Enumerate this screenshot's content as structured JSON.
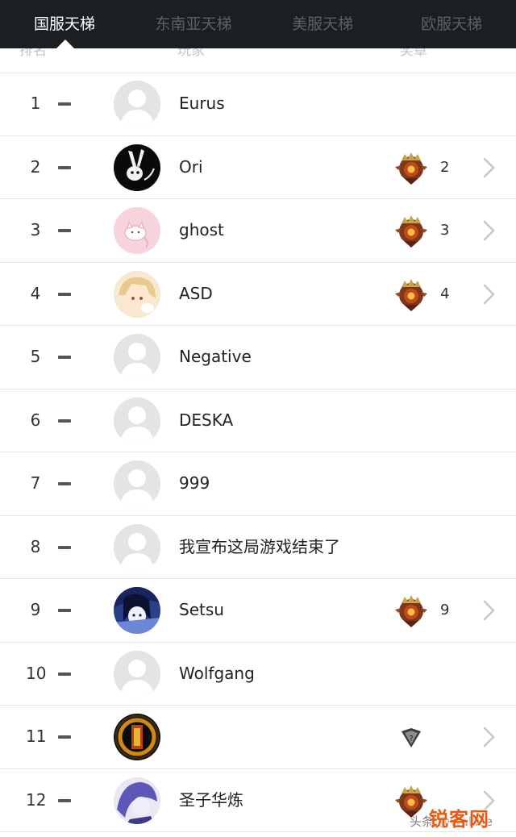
{
  "tabs": [
    {
      "label": "国服天梯",
      "active": true
    },
    {
      "label": "东南亚天梯",
      "active": false
    },
    {
      "label": "美服天梯",
      "active": false
    },
    {
      "label": "欧服天梯",
      "active": false
    }
  ],
  "columns": {
    "rank": "排名",
    "player": "玩家",
    "medal": "奖章"
  },
  "rows": [
    {
      "rank": "1",
      "name": "Eurus",
      "avatar": "default-avatar",
      "medal": null
    },
    {
      "rank": "2",
      "name": "Ori",
      "avatar": "rabbit-avatar",
      "medal": {
        "icon": "immortal-medal-icon",
        "count": "2"
      }
    },
    {
      "rank": "3",
      "name": "ghost",
      "avatar": "pink-cat-avatar",
      "medal": {
        "icon": "immortal-medal-icon",
        "count": "3"
      }
    },
    {
      "rank": "4",
      "name": "ASD",
      "avatar": "anime-avatar",
      "medal": {
        "icon": "immortal-medal-icon",
        "count": "4"
      }
    },
    {
      "rank": "5",
      "name": "Negative",
      "avatar": "default-avatar",
      "medal": null
    },
    {
      "rank": "6",
      "name": "DESKA",
      "avatar": "default-avatar",
      "medal": null
    },
    {
      "rank": "7",
      "name": "999",
      "avatar": "default-avatar",
      "medal": null
    },
    {
      "rank": "8",
      "name": "我宣布这局游戏结束了",
      "avatar": "default-avatar",
      "medal": null
    },
    {
      "rank": "9",
      "name": "Setsu",
      "avatar": "anime-blue-avatar",
      "medal": {
        "icon": "immortal-medal-icon",
        "count": "9"
      }
    },
    {
      "rank": "10",
      "name": "Wolfgang",
      "avatar": "default-avatar",
      "medal": null
    },
    {
      "rank": "11",
      "name": "",
      "avatar": "dark-orange-avatar",
      "medal": {
        "icon": "uncalibrated-medal-icon",
        "count": ""
      }
    },
    {
      "rank": "12",
      "name": "圣子华炼",
      "avatar": "purple-avatar",
      "medal": {
        "icon": "immortal-medal-icon",
        "count": ""
      }
    }
  ],
  "watermark": {
    "brand": "锐客网",
    "sub": "头条 @Wallice"
  },
  "colors": {
    "topbar": "#1c1f22",
    "active_tab": "#ffffff",
    "inactive_tab": "#5d6064",
    "brand": "#e65a12"
  }
}
